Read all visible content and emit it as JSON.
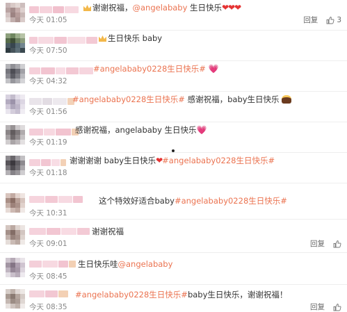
{
  "actions": {
    "reply_label": "回复",
    "like_count": "3"
  },
  "comments": [
    {
      "text": "谢谢祝福，",
      "mention": "@angelababy",
      "text_after": " 生日快乐",
      "time": "今天 01:05"
    },
    {
      "text": "生日快乐 baby",
      "time": "今天 07:50"
    },
    {
      "tag": "#angelababy0228生日快乐#",
      "time": "今天 04:32"
    },
    {
      "tag": "#angelababy0228生日快乐#",
      "text_after": " 感谢祝福，baby生日快乐",
      "time": "今天 01:56"
    },
    {
      "text": "感谢祝福，angelababy 生日快乐",
      "time": "今天 01:19"
    },
    {
      "text": "谢谢谢谢 baby生日快乐",
      "tag": "#angelababy0228生日快乐#",
      "time": "今天 01:18"
    },
    {
      "text": "这个特效好适合baby",
      "tag": "#angelababy0228生日快乐#",
      "time": "今天 10:31"
    },
    {
      "text": "谢谢祝福",
      "time": "今天 09:01"
    },
    {
      "text": "生日快乐哇",
      "mention": "@angelababy",
      "time": "今天 08:45"
    },
    {
      "tag": "#angelababy0228生日快乐#",
      "text_after": "baby生日快乐，谢谢祝福！",
      "time": "今天 08:35"
    }
  ],
  "colors": {
    "accent_link": "#eb7350",
    "time_text": "#888888",
    "body_text": "#333333"
  }
}
